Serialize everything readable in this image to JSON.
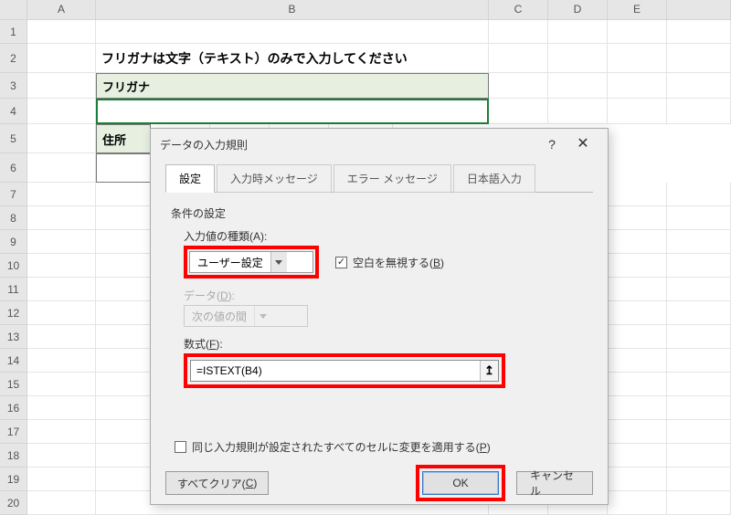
{
  "columns": [
    "A",
    "B",
    "C",
    "D",
    "E"
  ],
  "rows": [
    1,
    2,
    3,
    4,
    5,
    6,
    7,
    8,
    9,
    10,
    11,
    12,
    13,
    14,
    15,
    16,
    17,
    18,
    19,
    20
  ],
  "cells": {
    "B2": "フリガナは文字（テキスト）のみで入力してください",
    "B3": "フリガナ",
    "B5": "住所"
  },
  "dialog": {
    "title": "データの入力規則",
    "help": "?",
    "close": "✕",
    "tabs": {
      "settings": "設定",
      "input_msg": "入力時メッセージ",
      "error_msg": "エラー メッセージ",
      "ime": "日本語入力"
    },
    "section": "条件の設定",
    "allow_label": "入力値の種類(A):",
    "allow_value": "ユーザー設定",
    "ignore_blank_label": "空白を無視する(B)",
    "ignore_blank_checked": true,
    "data_label": "データ(D):",
    "data_value": "次の値の間",
    "formula_label": "数式(F):",
    "formula_value": "=ISTEXT(B4)",
    "apply_all_label": "同じ入力規則が設定されたすべてのセルに変更を適用する(P)",
    "apply_all_checked": false,
    "clear_label": "すべてクリア(C)",
    "ok_label": "OK",
    "cancel_label": "キャンセル"
  }
}
